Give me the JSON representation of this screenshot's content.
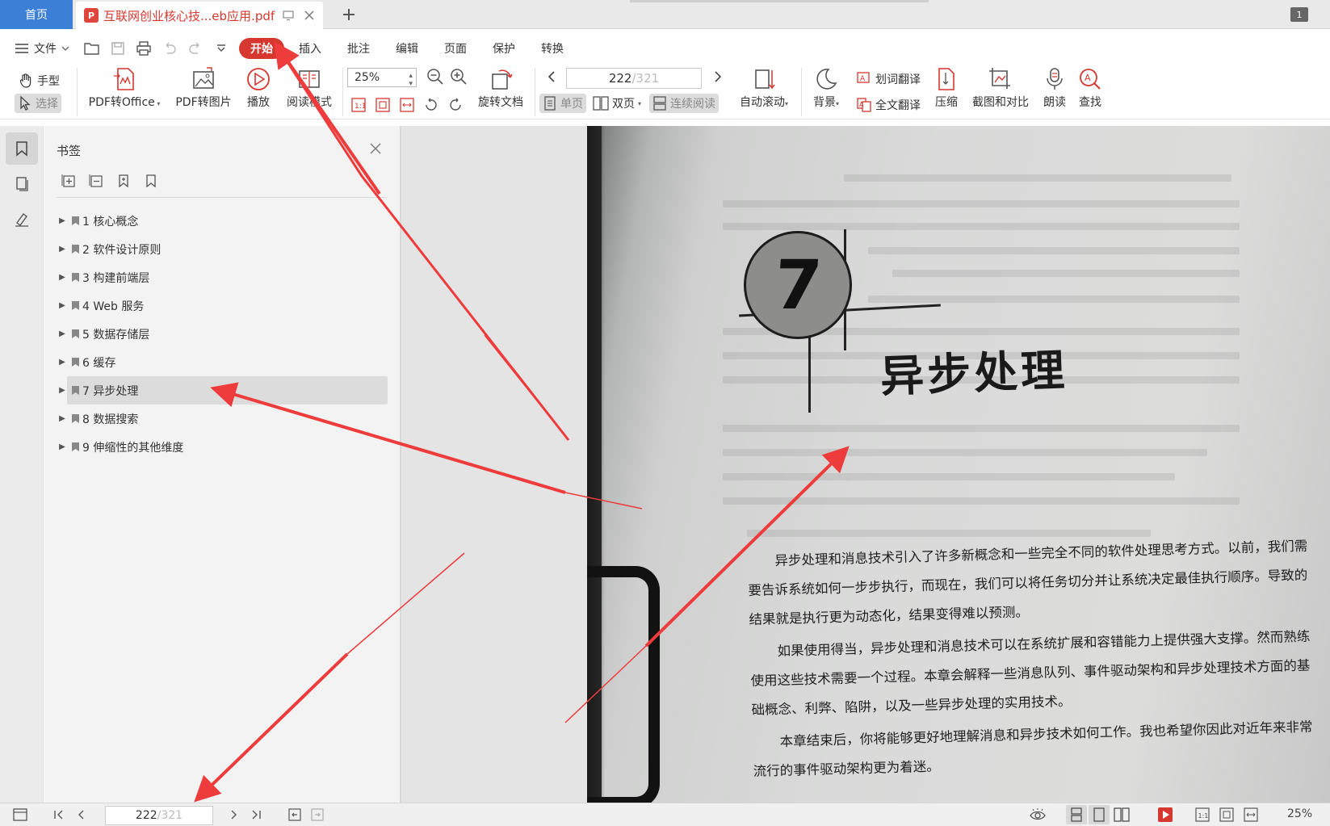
{
  "tabs": {
    "home_label": "首页",
    "doc_badge": "P",
    "doc_title": "互联网创业核心技...eb应用.pdf",
    "window_count": "1"
  },
  "menu": {
    "file_label": "文件",
    "tabs": [
      "开始",
      "插入",
      "批注",
      "编辑",
      "页面",
      "保护",
      "转换"
    ]
  },
  "ribbon": {
    "hand_label": "手型",
    "select_label": "选择",
    "pdf_to_office": "PDF转Office",
    "pdf_to_image": "PDF转图片",
    "play": "播放",
    "reading_mode": "阅读模式",
    "zoom_value": "25%",
    "rotate_doc": "旋转文档",
    "page_current": "222",
    "page_total": "/321",
    "single_page": "单页",
    "double_page": "双页",
    "continuous": "连续阅读",
    "auto_scroll": "自动滚动",
    "background": "背景",
    "word_translate": "划词翻译",
    "full_translate": "全文翻译",
    "compress": "压缩",
    "screenshot_compare": "截图和对比",
    "read_aloud": "朗读",
    "find": "查找"
  },
  "bookmarks": {
    "title": "书签",
    "items": [
      {
        "label": "1 核心概念"
      },
      {
        "label": "2 软件设计原则"
      },
      {
        "label": "3 构建前端层"
      },
      {
        "label": "4 Web 服务"
      },
      {
        "label": "5 数据存储层"
      },
      {
        "label": "6 缓存"
      },
      {
        "label": "7 异步处理"
      },
      {
        "label": "8 数据搜索"
      },
      {
        "label": "9 伸缩性的其他维度"
      }
    ],
    "selected_index": 6
  },
  "page": {
    "chapter_number": "7",
    "chapter_title": "异步处理",
    "paragraphs": [
      "异步处理和消息技术引入了许多新概念和一些完全不同的软件处理思考方式。以前，我们需要告诉系统如何一步步执行，而现在，我们可以将任务切分并让系统决定最佳执行顺序。导致的结果就是执行更为动态化，结果变得难以预测。",
      "如果使用得当，异步处理和消息技术可以在系统扩展和容错能力上提供强大支撑。然而熟练使用这些技术需要一个过程。本章会解释一些消息队列、事件驱动架构和异步处理技术方面的基础概念、利弊、陷阱，以及一些异步处理的实用技术。",
      "本章结束后，你将能够更好地理解消息和异步技术如何工作。我也希望你因此对近年来非常流行的事件驱动架构更为着迷。"
    ]
  },
  "statusbar": {
    "page_current": "222",
    "page_total": "/321",
    "zoom": "25%"
  },
  "colors": {
    "accent_red": "#d6372f",
    "home_tab_blue": "#3c7fd7",
    "arrow_red": "#ee3b3b"
  }
}
